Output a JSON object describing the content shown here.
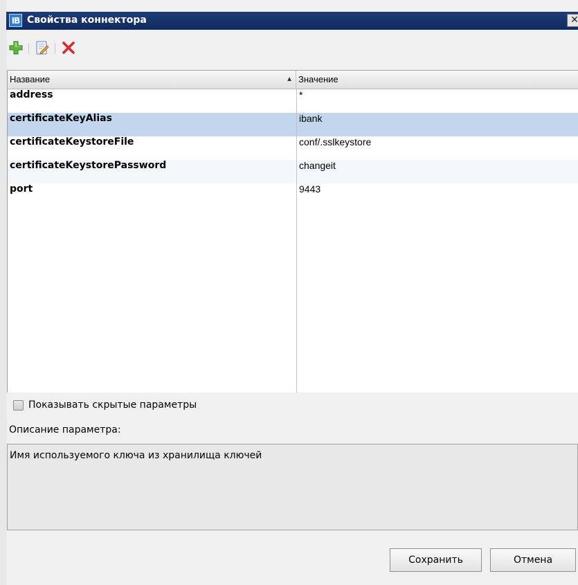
{
  "window": {
    "title": "Свойства коннектора",
    "app_icon_text": "IB",
    "close_glyph": "✕"
  },
  "toolbar": {
    "items": [
      {
        "icon": "plus-icon",
        "color": "#5bb83a"
      },
      {
        "icon": "edit-icon",
        "color": "#e8a23c"
      },
      {
        "icon": "delete-icon",
        "color": "#d9272e"
      }
    ]
  },
  "table": {
    "columns": {
      "name": "Название",
      "value": "Значение",
      "sort_indicator": "▲"
    },
    "rows": [
      {
        "name": "address",
        "value": "*"
      },
      {
        "name": "certificateKeyAlias",
        "value": "ibank"
      },
      {
        "name": "certificateKeystoreFile",
        "value": "conf/.sslkeystore"
      },
      {
        "name": "certificateKeystorePassword",
        "value": "changeit"
      },
      {
        "name": "port",
        "value": "9443"
      }
    ],
    "selected_row": 1,
    "selection_color": "#c2d7ee"
  },
  "options": {
    "show_hidden_label": "Показывать скрытые параметры",
    "show_hidden_checked": false
  },
  "description": {
    "label": "Описание параметра:",
    "text": "Имя используемого ключа из хранилища ключей"
  },
  "buttons": {
    "save": "Сохранить",
    "cancel": "Отмена"
  }
}
